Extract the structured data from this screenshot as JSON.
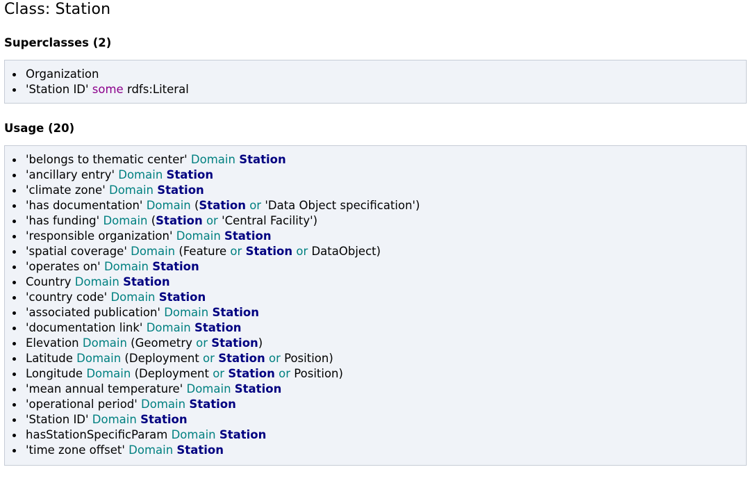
{
  "title": "Class: Station",
  "superclasses": {
    "heading": "Superclasses (2)",
    "items": [
      [
        {
          "t": "Organization",
          "k": "plain"
        }
      ],
      [
        {
          "t": "'Station ID' ",
          "k": "plain"
        },
        {
          "t": "some",
          "k": "some"
        },
        {
          "t": " rdfs:Literal",
          "k": "plain"
        }
      ]
    ]
  },
  "usage": {
    "heading": "Usage (20)",
    "items": [
      [
        {
          "t": "'belongs to thematic center' ",
          "k": "plain"
        },
        {
          "t": "Domain",
          "k": "kw"
        },
        {
          "t": " ",
          "k": "plain"
        },
        {
          "t": "Station",
          "k": "cls"
        }
      ],
      [
        {
          "t": "'ancillary entry' ",
          "k": "plain"
        },
        {
          "t": "Domain",
          "k": "kw"
        },
        {
          "t": " ",
          "k": "plain"
        },
        {
          "t": "Station",
          "k": "cls"
        }
      ],
      [
        {
          "t": "'climate zone' ",
          "k": "plain"
        },
        {
          "t": "Domain",
          "k": "kw"
        },
        {
          "t": " ",
          "k": "plain"
        },
        {
          "t": "Station",
          "k": "cls"
        }
      ],
      [
        {
          "t": "'has documentation' ",
          "k": "plain"
        },
        {
          "t": "Domain",
          "k": "kw"
        },
        {
          "t": " (",
          "k": "plain"
        },
        {
          "t": "Station",
          "k": "cls"
        },
        {
          "t": " ",
          "k": "plain"
        },
        {
          "t": "or",
          "k": "kw"
        },
        {
          "t": " 'Data Object specification')",
          "k": "plain"
        }
      ],
      [
        {
          "t": "'has funding' ",
          "k": "plain"
        },
        {
          "t": "Domain",
          "k": "kw"
        },
        {
          "t": " (",
          "k": "plain"
        },
        {
          "t": "Station",
          "k": "cls"
        },
        {
          "t": " ",
          "k": "plain"
        },
        {
          "t": "or",
          "k": "kw"
        },
        {
          "t": " 'Central Facility')",
          "k": "plain"
        }
      ],
      [
        {
          "t": "'responsible organization' ",
          "k": "plain"
        },
        {
          "t": "Domain",
          "k": "kw"
        },
        {
          "t": " ",
          "k": "plain"
        },
        {
          "t": "Station",
          "k": "cls"
        }
      ],
      [
        {
          "t": "'spatial coverage' ",
          "k": "plain"
        },
        {
          "t": "Domain",
          "k": "kw"
        },
        {
          "t": " (Feature ",
          "k": "plain"
        },
        {
          "t": "or",
          "k": "kw"
        },
        {
          "t": " ",
          "k": "plain"
        },
        {
          "t": "Station",
          "k": "cls"
        },
        {
          "t": " ",
          "k": "plain"
        },
        {
          "t": "or",
          "k": "kw"
        },
        {
          "t": " DataObject)",
          "k": "plain"
        }
      ],
      [
        {
          "t": "'operates on' ",
          "k": "plain"
        },
        {
          "t": "Domain",
          "k": "kw"
        },
        {
          "t": " ",
          "k": "plain"
        },
        {
          "t": "Station",
          "k": "cls"
        }
      ],
      [
        {
          "t": "Country ",
          "k": "plain"
        },
        {
          "t": "Domain",
          "k": "kw"
        },
        {
          "t": " ",
          "k": "plain"
        },
        {
          "t": "Station",
          "k": "cls"
        }
      ],
      [
        {
          "t": "'country code' ",
          "k": "plain"
        },
        {
          "t": "Domain",
          "k": "kw"
        },
        {
          "t": " ",
          "k": "plain"
        },
        {
          "t": "Station",
          "k": "cls"
        }
      ],
      [
        {
          "t": "'associated publication' ",
          "k": "plain"
        },
        {
          "t": "Domain",
          "k": "kw"
        },
        {
          "t": " ",
          "k": "plain"
        },
        {
          "t": "Station",
          "k": "cls"
        }
      ],
      [
        {
          "t": "'documentation link' ",
          "k": "plain"
        },
        {
          "t": "Domain",
          "k": "kw"
        },
        {
          "t": " ",
          "k": "plain"
        },
        {
          "t": "Station",
          "k": "cls"
        }
      ],
      [
        {
          "t": "Elevation ",
          "k": "plain"
        },
        {
          "t": "Domain",
          "k": "kw"
        },
        {
          "t": " (Geometry ",
          "k": "plain"
        },
        {
          "t": "or",
          "k": "kw"
        },
        {
          "t": " ",
          "k": "plain"
        },
        {
          "t": "Station",
          "k": "cls"
        },
        {
          "t": ")",
          "k": "plain"
        }
      ],
      [
        {
          "t": "Latitude ",
          "k": "plain"
        },
        {
          "t": "Domain",
          "k": "kw"
        },
        {
          "t": " (Deployment ",
          "k": "plain"
        },
        {
          "t": "or",
          "k": "kw"
        },
        {
          "t": " ",
          "k": "plain"
        },
        {
          "t": "Station",
          "k": "cls"
        },
        {
          "t": " ",
          "k": "plain"
        },
        {
          "t": "or",
          "k": "kw"
        },
        {
          "t": " Position)",
          "k": "plain"
        }
      ],
      [
        {
          "t": "Longitude ",
          "k": "plain"
        },
        {
          "t": "Domain",
          "k": "kw"
        },
        {
          "t": " (Deployment ",
          "k": "plain"
        },
        {
          "t": "or",
          "k": "kw"
        },
        {
          "t": " ",
          "k": "plain"
        },
        {
          "t": "Station",
          "k": "cls"
        },
        {
          "t": " ",
          "k": "plain"
        },
        {
          "t": "or",
          "k": "kw"
        },
        {
          "t": " Position)",
          "k": "plain"
        }
      ],
      [
        {
          "t": "'mean annual temperature' ",
          "k": "plain"
        },
        {
          "t": "Domain",
          "k": "kw"
        },
        {
          "t": " ",
          "k": "plain"
        },
        {
          "t": "Station",
          "k": "cls"
        }
      ],
      [
        {
          "t": "'operational period' ",
          "k": "plain"
        },
        {
          "t": "Domain",
          "k": "kw"
        },
        {
          "t": " ",
          "k": "plain"
        },
        {
          "t": "Station",
          "k": "cls"
        }
      ],
      [
        {
          "t": "'Station ID' ",
          "k": "plain"
        },
        {
          "t": "Domain",
          "k": "kw"
        },
        {
          "t": " ",
          "k": "plain"
        },
        {
          "t": "Station",
          "k": "cls"
        }
      ],
      [
        {
          "t": "hasStationSpecificParam ",
          "k": "plain"
        },
        {
          "t": "Domain",
          "k": "kw"
        },
        {
          "t": " ",
          "k": "plain"
        },
        {
          "t": "Station",
          "k": "cls"
        }
      ],
      [
        {
          "t": "'time zone offset' ",
          "k": "plain"
        },
        {
          "t": "Domain",
          "k": "kw"
        },
        {
          "t": " ",
          "k": "plain"
        },
        {
          "t": "Station",
          "k": "cls"
        }
      ]
    ]
  },
  "colors": {
    "some_keyword": "#8b008b",
    "keyword": "#008080",
    "class_ref": "#000080",
    "box_background": "#f0f3f8",
    "box_border": "#c6ccd6"
  }
}
